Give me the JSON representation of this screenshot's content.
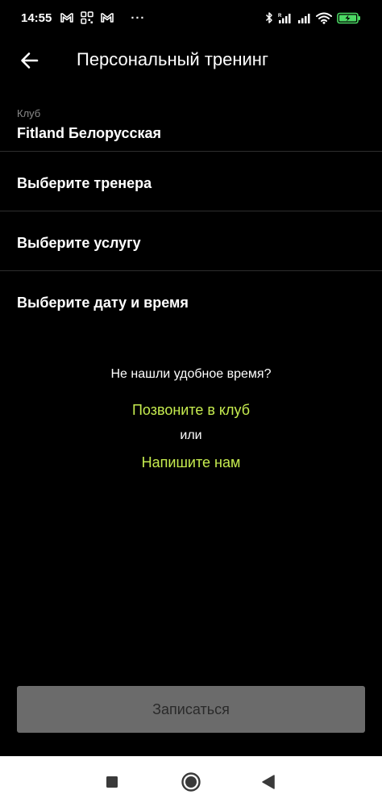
{
  "status_bar": {
    "time": "14:55",
    "more_indicator": "···",
    "left_icons": [
      "gmail-icon",
      "qr-scan-icon",
      "gmail-icon"
    ],
    "right_icons": [
      "bluetooth-icon",
      "cellular-signal-icon",
      "cellular-signal-icon",
      "wifi-icon",
      "battery-charging-icon"
    ],
    "battery_color": "#4cd964"
  },
  "app_bar": {
    "title": "Персональный тренинг",
    "back_icon": "arrow-left-icon"
  },
  "form": {
    "club_label": "Клуб",
    "club_value": "Fitland Белорусская",
    "trainer_label": "Выберите тренера",
    "service_label": "Выберите услугу",
    "datetime_label": "Выберите дату и время"
  },
  "help": {
    "question": "Не нашли удобное время?",
    "call_link": "Позвоните в клуб",
    "or_text": "или",
    "write_link": "Напишите нам",
    "link_color": "#c6ec4f"
  },
  "submit_label": "Записаться",
  "nav": {
    "recents_icon": "square-icon",
    "home_icon": "circle-icon",
    "back_icon": "triangle-back-icon"
  }
}
